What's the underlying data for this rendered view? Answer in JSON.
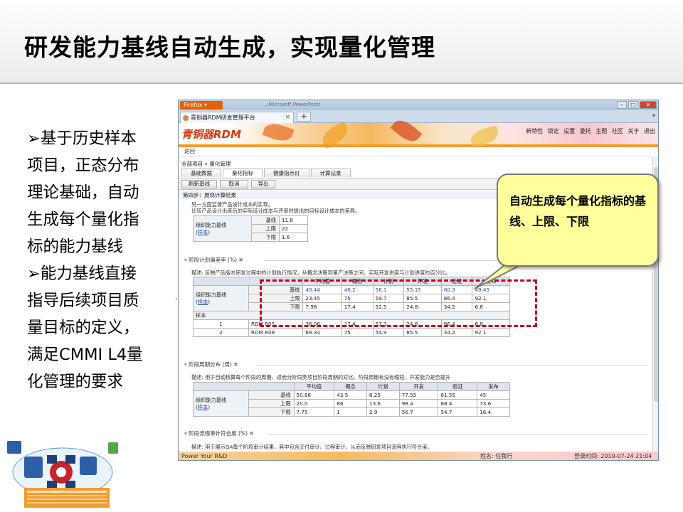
{
  "slide": {
    "title": "研发能力基线自动生成，实现量化管理",
    "bullets": [
      [
        "➢基于历史样本",
        "项目，正态分布",
        "理论基础，自动",
        "生成每个量化指",
        "标的能力基线"
      ],
      [
        "➢能力基线直接",
        "指导后续项目质",
        "量目标的定义，",
        "满足CMMI L4量",
        "化管理的要求"
      ]
    ],
    "callout": "自动生成每个量化指标的基线、上限、下限"
  },
  "browser": {
    "firefox_button": "Firefox ▾",
    "window_title": "...Microsoft PowerPoint",
    "tab_title": "青铜器RDM研发管理平台",
    "new_tab": "+",
    "logo": "青铜器RDM",
    "top_links": [
      "新特性",
      "锁定",
      "设置",
      "委托",
      "主题",
      "社区",
      "关于",
      "退出"
    ],
    "nav_back": "返回",
    "breadcrumb": "全部项目 » 量化管理",
    "tabs": [
      "基础数据",
      "量化指标",
      "健康指示灯",
      "计算记录"
    ],
    "buttons": [
      "刷新基线",
      "取消",
      "导出"
    ],
    "step": "第四步：展现计算结果",
    "desc1": "另一方面监督产品设计成本的实现。",
    "desc2": "比较产品设计出来后的实际设计成本与评审时提出的目标设计成本的差异。",
    "label_ability": "组织能力基线",
    "label_sample": "样本",
    "row_labels": [
      "基线",
      "上限",
      "下限"
    ],
    "table1": [
      "11.8",
      "22",
      "1.6"
    ],
    "sec2_title": "阶段计划偏差率 (%)",
    "sec2_desc": "描述: 反映产品版本研发过程中的计划执行情况，从概念决策到量产决策之间，实际开发进度与计划进度的百分比。",
    "sec2_headers": [
      "平均值",
      "概念",
      "计划",
      "开发",
      "验证",
      "发布"
    ],
    "sec2_rows": [
      [
        "40.44",
        "46.2",
        "56.1",
        "55.15",
        "60.3",
        "49.45"
      ],
      [
        "23.45",
        "75",
        "59.7",
        "85.5",
        "86.4",
        "92.1"
      ],
      [
        "7.98",
        "17.4",
        "52.5",
        "24.8",
        "34.2",
        "6.8"
      ]
    ],
    "sample_rows": [
      [
        "1",
        "RDM R05",
        "36.06",
        "17.4",
        "57.3",
        "24.8",
        "86.4",
        "6.8"
      ],
      [
        "2",
        "RDM R08",
        "68.34",
        "75",
        "54.9",
        "85.5",
        "34.2",
        "92.1"
      ]
    ],
    "sec3_title": "阶段周期分布 (周)",
    "sec3_desc": "描述: 用于自动核算每个阶段的周期，进而分析同类项目阶段周期的对比，阶段周期有没有缩短，开发能力是否提升",
    "sec3_headers": [
      "平均值",
      "概念",
      "计划",
      "开发",
      "验证",
      "发布"
    ],
    "sec3_rows": [
      [
        "50.88",
        "43.5",
        "8.25",
        "77.55",
        "61.55",
        "45"
      ],
      [
        "20.0",
        "86",
        "13.6",
        "98.4",
        "68.4",
        "73.6"
      ],
      [
        "7.75",
        "1",
        "2.9",
        "56.7",
        "54.7",
        "16.4"
      ]
    ],
    "sec4_title": "阶段流程审计符合度 (%)",
    "sec4_desc": "描述: 用于展示QA每个阶段审计结果，其中包含交付审计、过程审计，从而反映研发项目流程执行符合度。",
    "status_left": "Power Your R&D",
    "status_user": "姓名: 任我行",
    "status_time": "登录时间: 2010-07-24 21:04"
  },
  "colors": {
    "accent": "#f39c2b",
    "logo_red": "#d43a12",
    "callout_bg": "#ffff9c",
    "dash": "#c4001a"
  }
}
